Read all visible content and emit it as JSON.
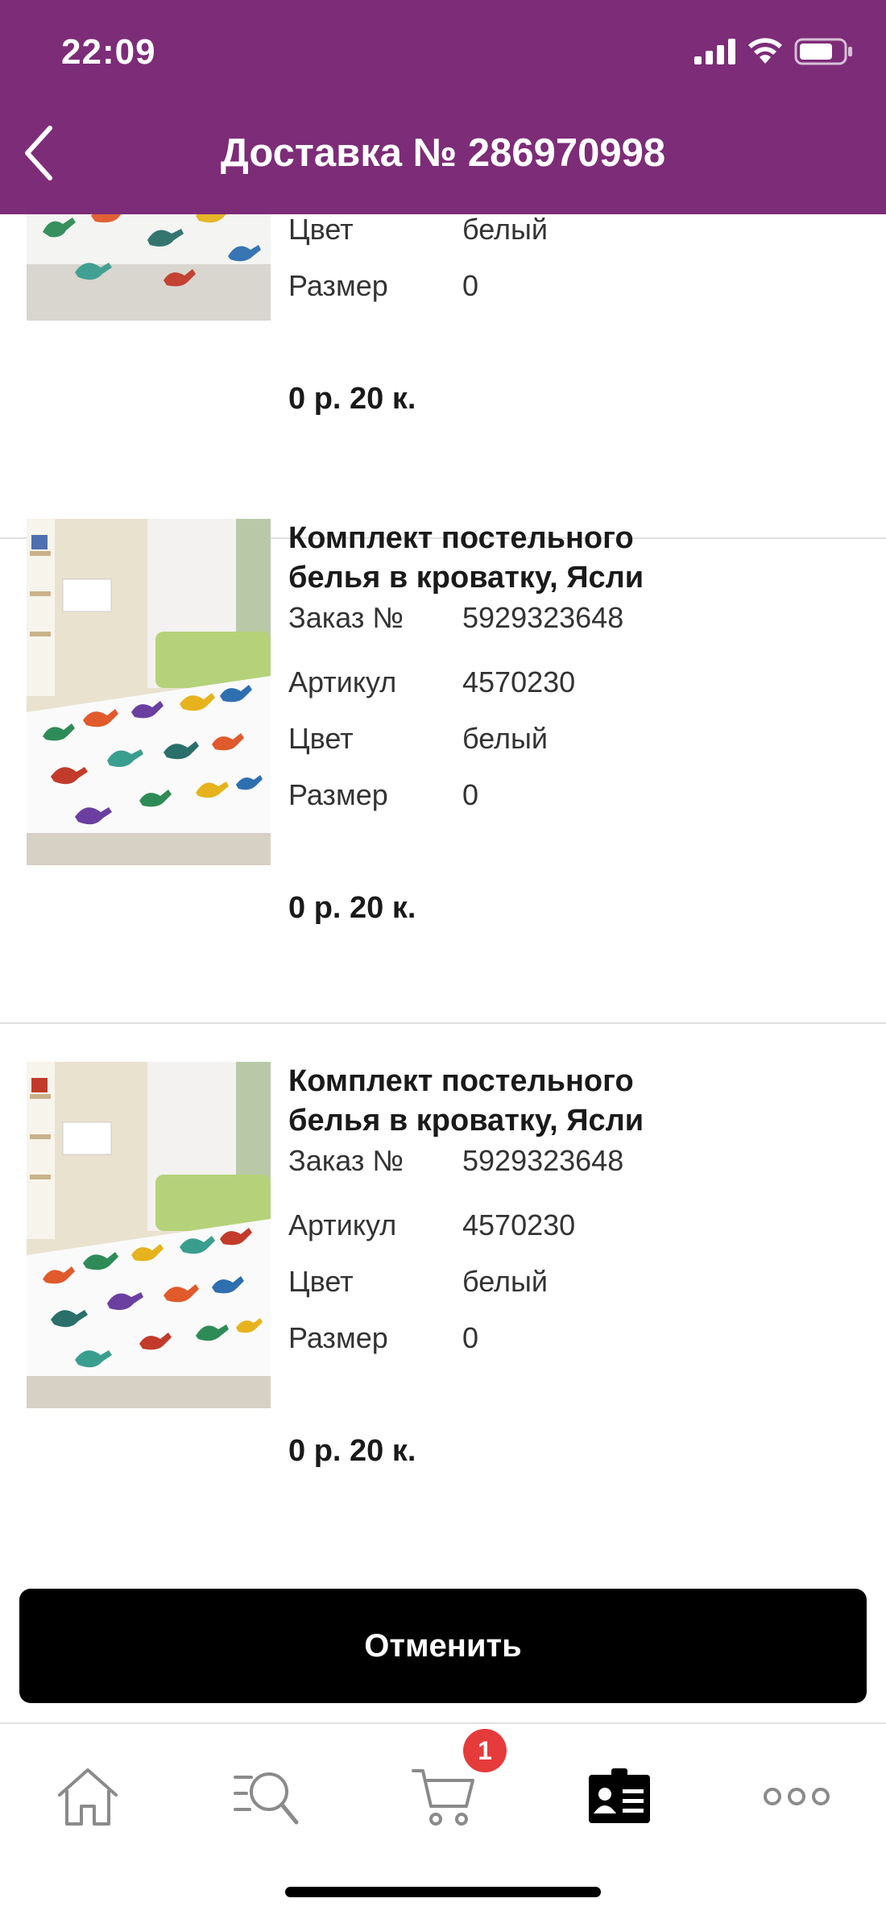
{
  "status_bar": {
    "time": "22:09"
  },
  "header": {
    "title": "Доставка № 286970998"
  },
  "labels": {
    "order": "Заказ №",
    "article": "Артикул",
    "color": "Цвет",
    "size": "Размер"
  },
  "items": [
    {
      "color": "белый",
      "size": "0",
      "price": "0 р. 20 к."
    },
    {
      "title_line1": "Комплект постельного",
      "title_line2": "белья в кроватку, Ясли",
      "order_no": "5929323648",
      "article": "4570230",
      "color": "белый",
      "size": "0",
      "price": "0 р. 20 к."
    },
    {
      "title_line1": "Комплект постельного",
      "title_line2": "белья в кроватку, Ясли",
      "order_no": "5929323648",
      "article": "4570230",
      "color": "белый",
      "size": "0",
      "price": "0 р. 20 к."
    }
  ],
  "actions": {
    "cancel_label": "Отменить"
  },
  "bottom_nav": {
    "items": [
      {
        "icon": "home-icon"
      },
      {
        "icon": "search-icon"
      },
      {
        "icon": "cart-icon"
      },
      {
        "icon": "profile-card-icon"
      },
      {
        "icon": "more-icon"
      }
    ],
    "cart_badge": "1"
  },
  "colors": {
    "header_bg": "#7d2c78",
    "accent_badge": "#e63b3b",
    "button_bg": "#000000"
  }
}
